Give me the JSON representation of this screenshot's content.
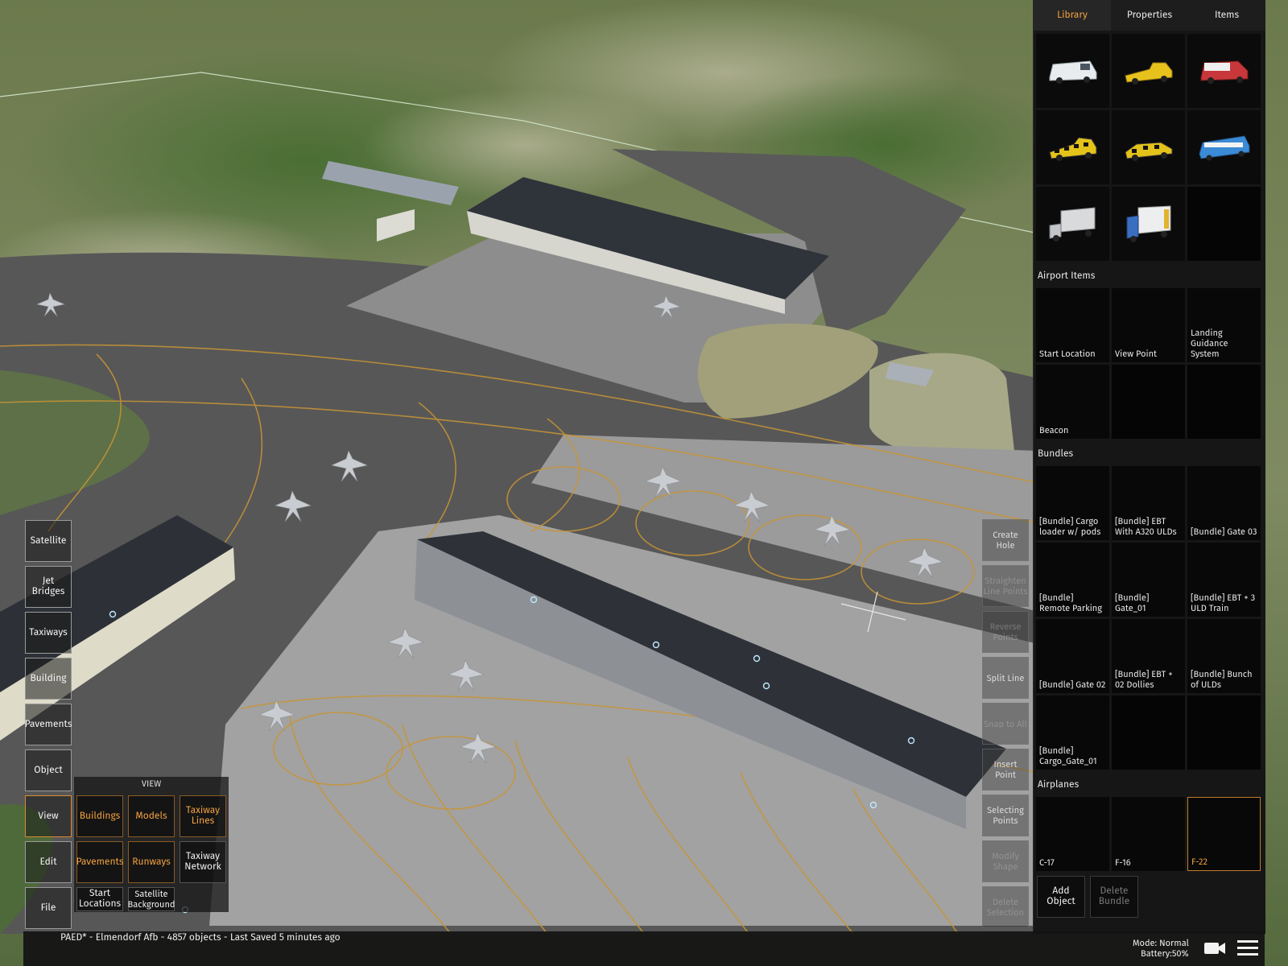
{
  "tabs": [
    {
      "label": "Library",
      "active": true
    },
    {
      "label": "Properties",
      "active": false
    },
    {
      "label": "Items",
      "active": false
    }
  ],
  "vehicles": [
    {
      "icon": "white-van-icon"
    },
    {
      "icon": "yellow-pickup-truck-icon"
    },
    {
      "icon": "red-van-icon"
    },
    {
      "icon": "follow-me-checker-truck-icon"
    },
    {
      "icon": "follow-me-checker-car-icon"
    },
    {
      "icon": "airport-bus-icon"
    },
    {
      "icon": "catering-truck-icon"
    },
    {
      "icon": "box-truck-icon"
    }
  ],
  "sections": {
    "airport_items": "Airport Items",
    "bundles": "Bundles",
    "airplanes": "Airplanes"
  },
  "airport_items": [
    "Start Location",
    "View Point",
    "Landing Guidance System",
    "Beacon"
  ],
  "bundles": [
    "[Bundle] Cargo loader w/ pods",
    "[Bundle] EBT With A320 ULDs",
    "[Bundle] Gate 03",
    "[Bundle] Remote Parking",
    "[Bundle] Gate_01",
    "[Bundle] EBT + 3 ULD Train",
    "[Bundle] Gate 02",
    "[Bundle] EBT + 02 Dollies",
    "[Bundle] Bunch of ULDs",
    "[Bundle] Cargo_Gate_01"
  ],
  "airplanes": [
    {
      "label": "C-17",
      "selected": false
    },
    {
      "label": "F-16",
      "selected": false
    },
    {
      "label": "F-22",
      "selected": true
    }
  ],
  "panel_buttons": {
    "add_object": "Add Object",
    "delete_bundle": "Delete Bundle"
  },
  "tools": [
    {
      "label": "Create Hole",
      "enabled": true
    },
    {
      "label": "Straighten Line Points",
      "enabled": false
    },
    {
      "label": "Reverse Points",
      "enabled": false
    },
    {
      "label": "Split Line",
      "enabled": true
    },
    {
      "label": "Snap to All",
      "enabled": false
    },
    {
      "label": "Insert Point",
      "enabled": true
    },
    {
      "label": "Selecting Points",
      "enabled": true
    },
    {
      "label": "Modify Shape",
      "enabled": false
    },
    {
      "label": "Delete Selection",
      "enabled": false
    }
  ],
  "left_buttons": [
    {
      "label": "Satellite",
      "selected": false
    },
    {
      "label": "Jet Bridges",
      "selected": false
    },
    {
      "label": "Taxiways",
      "selected": false
    },
    {
      "label": "Building",
      "selected": false
    },
    {
      "label": "Pavements",
      "selected": false
    },
    {
      "label": "Object",
      "selected": false
    },
    {
      "label": "View",
      "selected": true
    },
    {
      "label": "Edit",
      "selected": false
    },
    {
      "label": "File",
      "selected": false
    }
  ],
  "view_panel": {
    "title": "VIEW",
    "buttons": [
      {
        "label": "Buildings",
        "on": true
      },
      {
        "label": "Models",
        "on": true
      },
      {
        "label": "Taxiway Lines",
        "on": true
      },
      {
        "label": "Pavements",
        "on": true
      },
      {
        "label": "Runways",
        "on": true
      },
      {
        "label": "Taxiway Network",
        "on": false
      },
      {
        "label": "Start Locations",
        "on": false
      },
      {
        "label": "Satellite Background",
        "on": false
      }
    ]
  },
  "status": {
    "text": "PAED* - Elmendorf Afb - 4857 objects - Last Saved 5 minutes ago",
    "mode": "Mode: Normal",
    "battery": "Battery:50%"
  },
  "colors": {
    "accent": "#f0a040",
    "selected_border": "#c07a2a",
    "taxi_line": "#d49a2a"
  }
}
